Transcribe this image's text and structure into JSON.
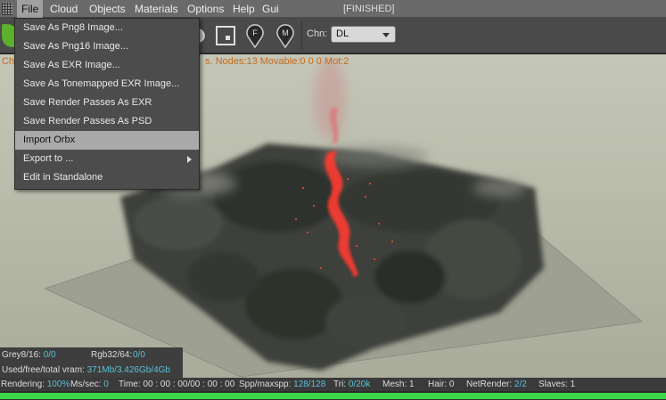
{
  "menubar": {
    "items": [
      "File",
      "Cloud",
      "Objects",
      "Materials",
      "Options",
      "Help",
      "Gui"
    ],
    "status": "[FINISHED]"
  },
  "toolbar": {
    "chn_label": "Chn:",
    "chn_value": "DL",
    "pin_f": "F",
    "pin_m": "M"
  },
  "viewport": {
    "stats_prefix": "Ch",
    "stats_text": "s. Nodes:13 Movable:0  0 0 Mot:2"
  },
  "file_menu": {
    "items": [
      "Save As Png8 Image...",
      "Save As Png16 Image...",
      "Save As EXR Image...",
      "Save As Tonemapped EXR Image...",
      "Save Render Passes As EXR",
      "Save Render Passes As PSD",
      "Import Orbx",
      "Export to ...",
      "Edit in Standalone"
    ],
    "selected": "Import Orbx"
  },
  "info": {
    "grey_label": "Grey8/16:",
    "grey_value": "0/0",
    "rgb_label": "Rgb32/64:",
    "rgb_value": "0/0",
    "vram_label": "Used/free/total vram:",
    "vram_value": "371Mb/3.426Gb/4Gb"
  },
  "statusbar": {
    "rendering_label": "Rendering:",
    "rendering_value": "100%",
    "mssec_label": "Ms/sec:",
    "mssec_value": "0",
    "time_label": "Time:",
    "time_value": "00 : 00 : 00/00 : 00 : 00",
    "spp_label": "Spp/maxspp:",
    "spp_value": "128/128",
    "tri_label": "Tri:",
    "tri_value": "0/20k",
    "mesh_label": "Mesh:",
    "mesh_value": "1",
    "hair_label": "Hair:",
    "hair_value": "0",
    "netrender_label": "NetRender:",
    "netrender_value": "2/2",
    "slaves_label": "Slaves:",
    "slaves_value": "1"
  },
  "progress_fraction": 1.0,
  "colors": {
    "accent_value": "#5bc0d6",
    "warning_text": "#c86a1a",
    "progress": "#3ed64a"
  }
}
